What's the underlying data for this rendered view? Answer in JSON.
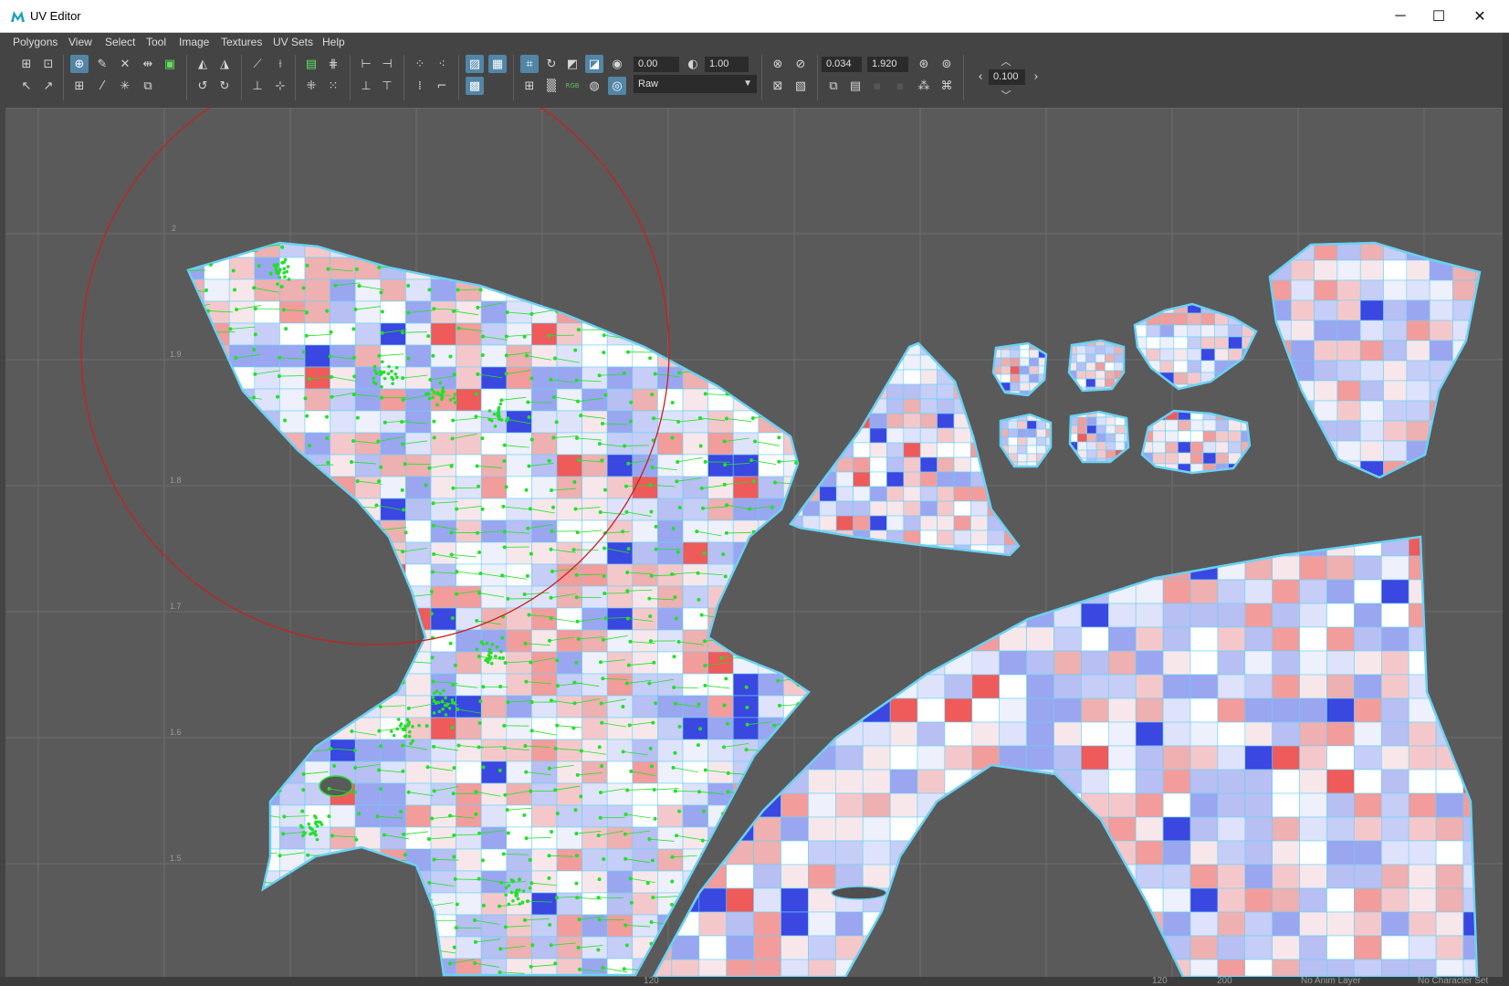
{
  "window": {
    "title": "UV Editor",
    "controls": {
      "minimize": "─",
      "maximize": "☐",
      "close": "✕"
    }
  },
  "menu": [
    "Polygons",
    "View",
    "Select",
    "Tool",
    "Image",
    "Textures",
    "UV Sets",
    "Help"
  ],
  "toolbar": {
    "exposure_value": "0.00",
    "gamma_value": "1.00",
    "color_space": "Raw",
    "texel_density_value": "0.034",
    "map_size_value": "1.920",
    "step_value": "0.100"
  },
  "viewport": {
    "grid_labels": [
      "2",
      "1.9",
      "1.8",
      "1.7",
      "1.6",
      "1.5"
    ],
    "colors": {
      "background": "#5a5a5a",
      "grid": "#6d6d6d",
      "shell_border": "#69d2f5",
      "selection_vertex": "#22e02a",
      "brush_circle": "#c8201e",
      "stretch_red": "#f29c9c",
      "stretch_blue": "#9aa6ef",
      "compress_blue": "#3a47e0"
    }
  },
  "status_bar": {
    "items": [
      "120",
      "120",
      "200",
      "No Anim Layer",
      "No Character Set"
    ]
  }
}
